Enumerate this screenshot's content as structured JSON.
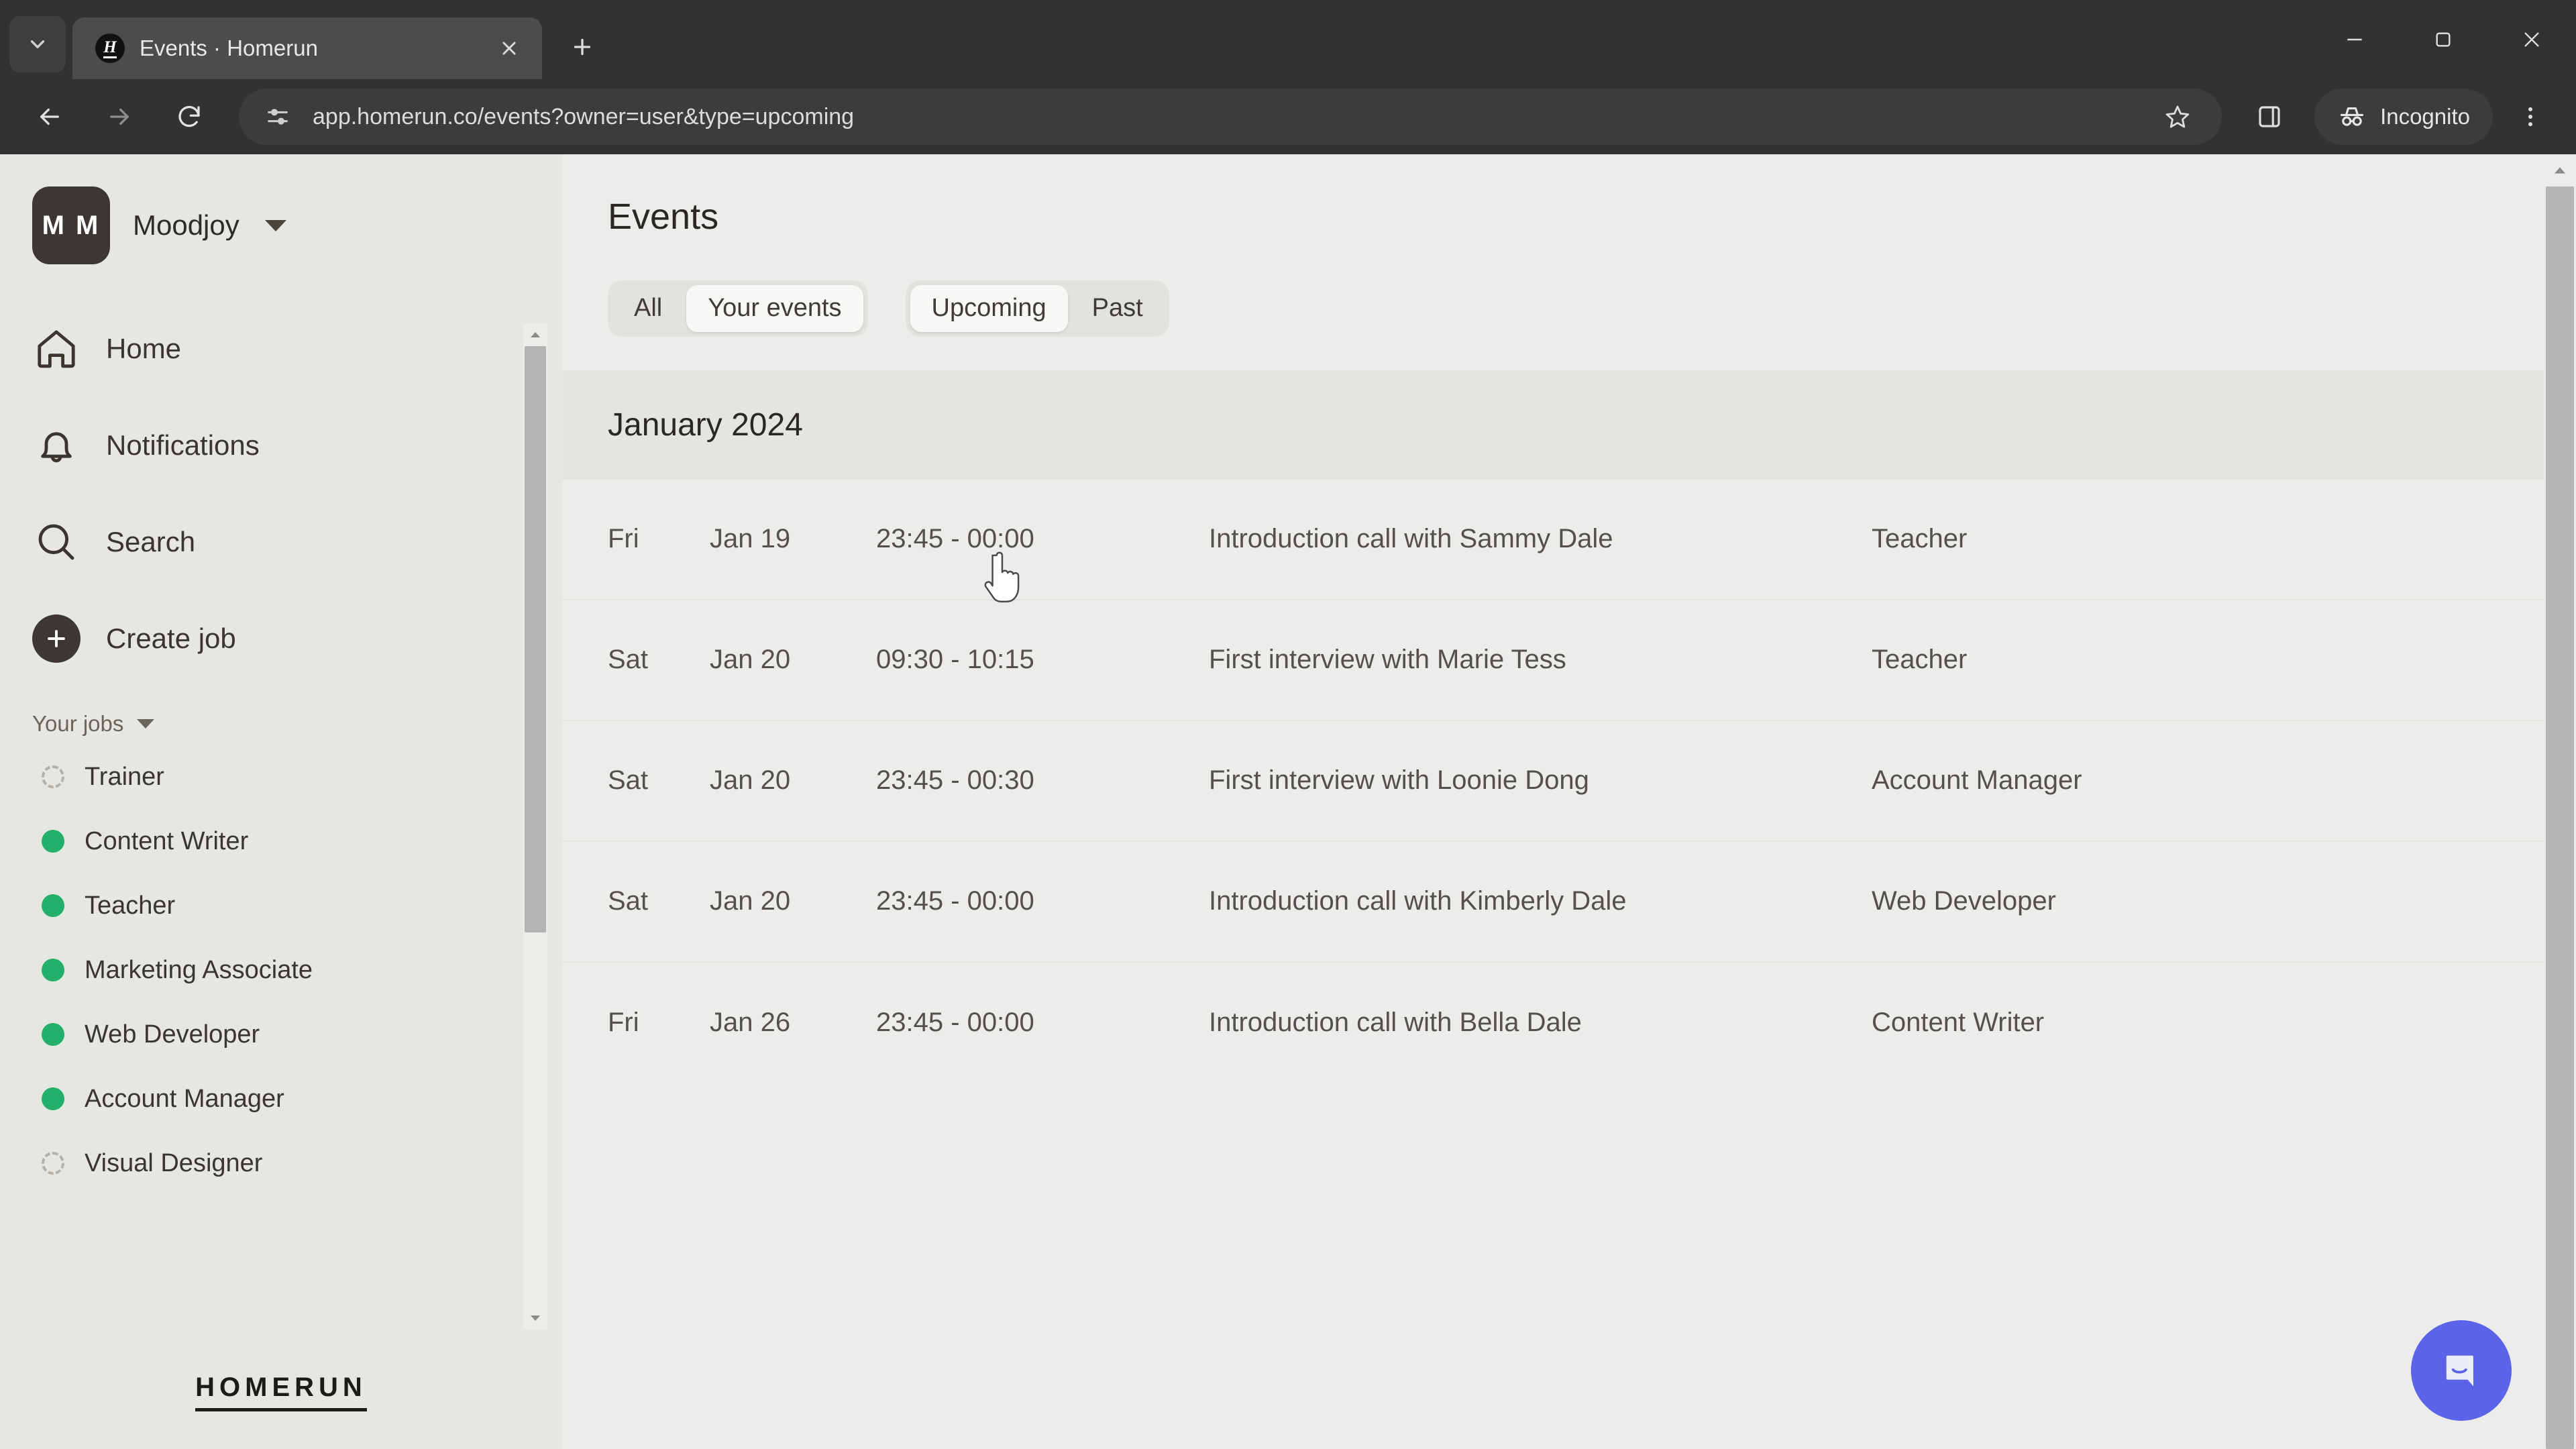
{
  "browser": {
    "tab": {
      "title": "Events · Homerun",
      "favicon_letter": "H"
    },
    "tab_search_icon": "chevron-down-icon",
    "new_tab_label": "+",
    "url": "app.homerun.co/events?owner=user&type=upcoming",
    "profile_label": "Incognito",
    "icons": {
      "back": "back-arrow-icon",
      "forward": "forward-arrow-icon",
      "reload": "reload-icon",
      "site_info": "site-settings-icon",
      "bookmark": "star-icon",
      "side_panel": "side-panel-icon",
      "incognito": "incognito-icon",
      "menu": "three-dot-menu-icon",
      "minimize": "minimize-icon",
      "maximize": "maximize-icon",
      "close": "close-icon"
    }
  },
  "sidebar": {
    "org": {
      "initials": "M M",
      "name": "Moodjoy"
    },
    "nav": [
      {
        "label": "Home",
        "icon": "home-icon"
      },
      {
        "label": "Notifications",
        "icon": "bell-icon"
      },
      {
        "label": "Search",
        "icon": "search-icon"
      },
      {
        "label": "Create job",
        "icon": "plus-circle-icon"
      }
    ],
    "jobs_section": {
      "label": "Your jobs",
      "caret": "chevron-down-icon"
    },
    "jobs": [
      {
        "label": "Trainer",
        "status": "draft"
      },
      {
        "label": "Content Writer",
        "status": "active"
      },
      {
        "label": "Teacher",
        "status": "active"
      },
      {
        "label": "Marketing Associate",
        "status": "active"
      },
      {
        "label": "Web Developer",
        "status": "active"
      },
      {
        "label": "Account Manager",
        "status": "active"
      },
      {
        "label": "Visual Designer",
        "status": "draft"
      }
    ],
    "footer_wordmark": "HOMERUN"
  },
  "main": {
    "title": "Events",
    "filters": {
      "owner": {
        "options": [
          "All",
          "Your events"
        ],
        "selected": "Your events"
      },
      "time": {
        "options": [
          "Upcoming",
          "Past"
        ],
        "selected": "Upcoming"
      }
    },
    "month": "January 2024",
    "events": [
      {
        "day": "Fri",
        "date": "Jan 19",
        "time": "23:45 - 00:00",
        "title": "Introduction call with Sammy Dale",
        "job": "Teacher"
      },
      {
        "day": "Sat",
        "date": "Jan 20",
        "time": "09:30 - 10:15",
        "title": "First interview with Marie Tess",
        "job": "Teacher"
      },
      {
        "day": "Sat",
        "date": "Jan 20",
        "time": "23:45 - 00:30",
        "title": "First interview with Loonie Dong",
        "job": "Account Manager"
      },
      {
        "day": "Sat",
        "date": "Jan 20",
        "time": "23:45 - 00:00",
        "title": "Introduction call with Kimberly Dale",
        "job": "Web Developer"
      },
      {
        "day": "Fri",
        "date": "Jan 26",
        "time": "23:45 - 00:00",
        "title": "Introduction call with Bella Dale",
        "job": "Content Writer"
      }
    ]
  },
  "chat_widget": {
    "icon": "chat-bubble-icon",
    "color": "#5b63e8"
  },
  "colors": {
    "sidebar_bg": "#e7e7e2",
    "main_bg": "#ececea",
    "month_band": "#e4e4e0",
    "status_active": "#22b06a",
    "status_draft": "#b5b0a8",
    "accent_dark": "#3c3733"
  }
}
